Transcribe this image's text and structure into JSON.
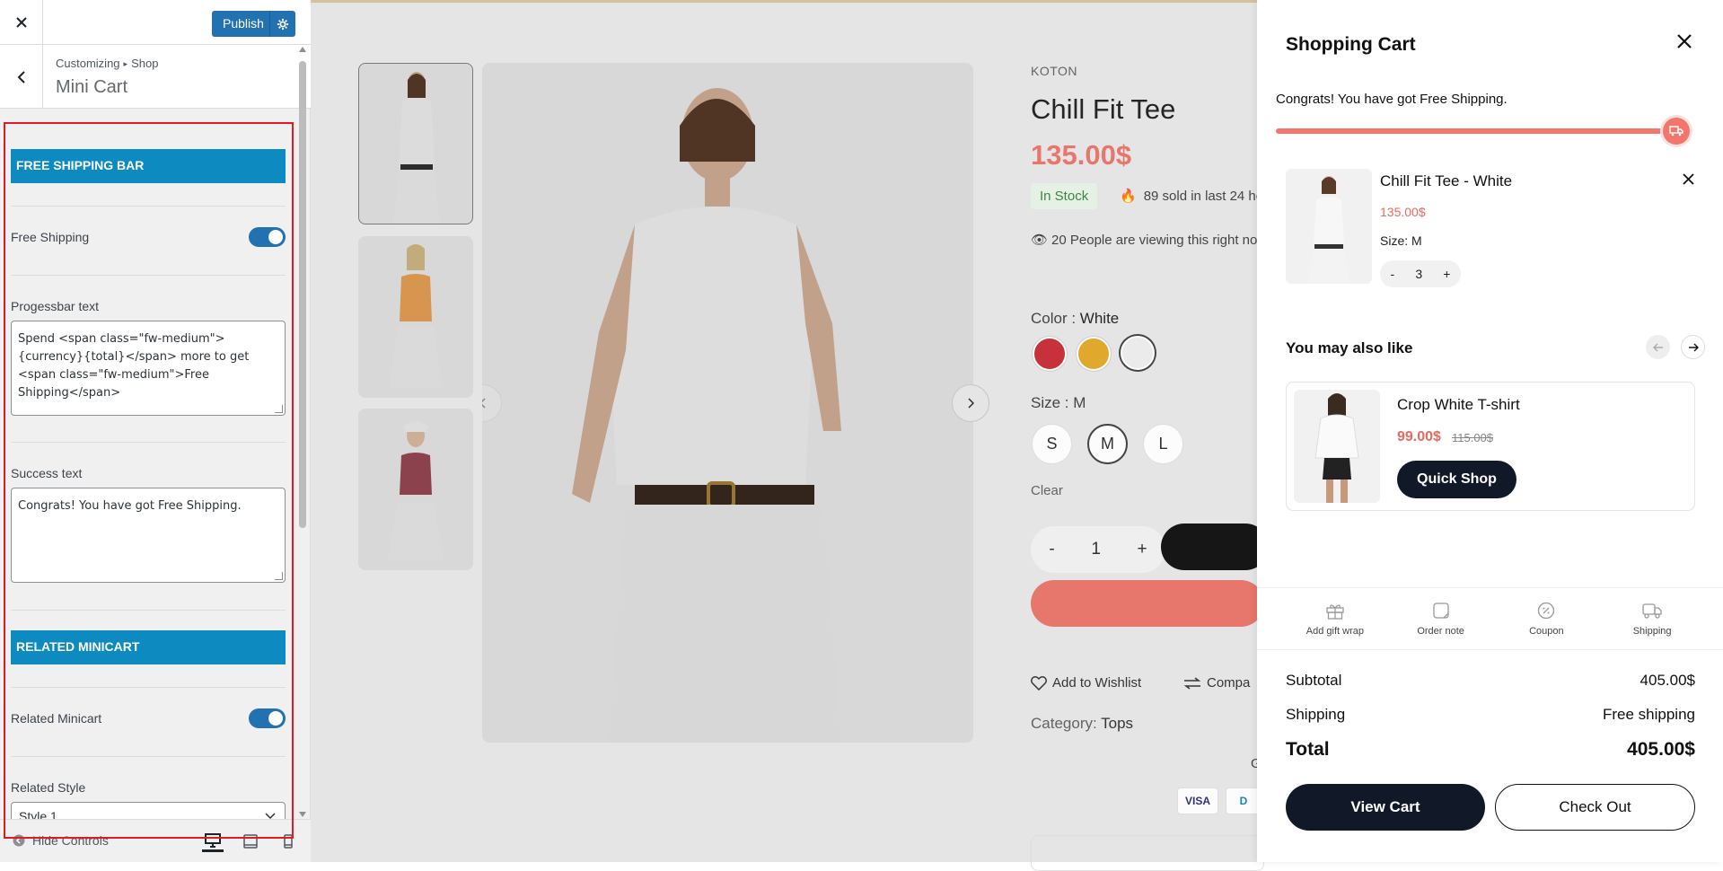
{
  "customizer": {
    "publish_label": "Publish",
    "breadcrumb_root": "Customizing",
    "breadcrumb_section": "Shop",
    "panel_title": "Mini Cart",
    "sections": {
      "free_shipping_bar": "FREE SHIPPING BAR",
      "related_minicart": "RELATED MINICART"
    },
    "fields": {
      "free_shipping_label": "Free Shipping",
      "free_shipping_enabled": true,
      "progressbar_label": "Progessbar text",
      "progressbar_value": "Spend <span class=\"fw-medium\">{currency}{total}</span> more to get <span class=\"fw-medium\">Free Shipping</span>",
      "success_label": "Success text",
      "success_value": "Congrats! You have got Free Shipping.",
      "related_minicart_label": "Related Minicart",
      "related_minicart_enabled": true,
      "related_style_label": "Related Style",
      "related_style_value": "Style 1"
    },
    "footer": {
      "hide_controls_label": "Hide Controls"
    },
    "accent_color": "#2271b1",
    "section_color": "#0d8abf"
  },
  "product": {
    "brand": "KOTON",
    "title": "Chill Fit Tee",
    "price": "135.00$",
    "stock": "In Stock",
    "sold": "89 sold in last 24 ho",
    "viewing": "20 People are viewing this right no",
    "color_label": "Color : ",
    "color_value": "White",
    "colors": [
      "#c41e2a",
      "#e0a31a",
      "#ececec"
    ],
    "size_label": "Size : ",
    "size_value": "M",
    "sizes": [
      "S",
      "M",
      "L"
    ],
    "clear_label": "Clear",
    "qty_minus": "-",
    "qty_value": "1",
    "qty_plus": "+",
    "wishlist_label": "Add to Wishlist",
    "compare_label": "Compa",
    "category_label": "Category: ",
    "category_value": "Tops",
    "guarantee_fragment": "G",
    "payment_visa": "VISA",
    "payment_diners": "D"
  },
  "cart": {
    "title": "Shopping Cart",
    "congrats": "Congrats! You have got Free Shipping.",
    "progress_percent": 100,
    "item": {
      "name": "Chill Fit Tee - White",
      "price": "135.00$",
      "size": "Size: M",
      "qty_minus": "-",
      "qty": "3",
      "qty_plus": "+"
    },
    "also_like_title": "You may also like",
    "related": {
      "name": "Crop White T-shirt",
      "price": "99.00$",
      "old_price": "115.00$",
      "button": "Quick Shop"
    },
    "tools": [
      {
        "icon": "gift-icon",
        "label": "Add gift wrap"
      },
      {
        "icon": "note-icon",
        "label": "Order note"
      },
      {
        "icon": "coupon-icon",
        "label": "Coupon"
      },
      {
        "icon": "truck-icon",
        "label": "Shipping"
      }
    ],
    "subtotal_label": "Subtotal",
    "subtotal_value": "405.00$",
    "shipping_label": "Shipping",
    "shipping_value": "Free shipping",
    "total_label": "Total",
    "total_value": "405.00$",
    "view_cart": "View Cart",
    "checkout": "Check Out",
    "accent_color": "#f2766b",
    "dark_color": "#111827"
  }
}
